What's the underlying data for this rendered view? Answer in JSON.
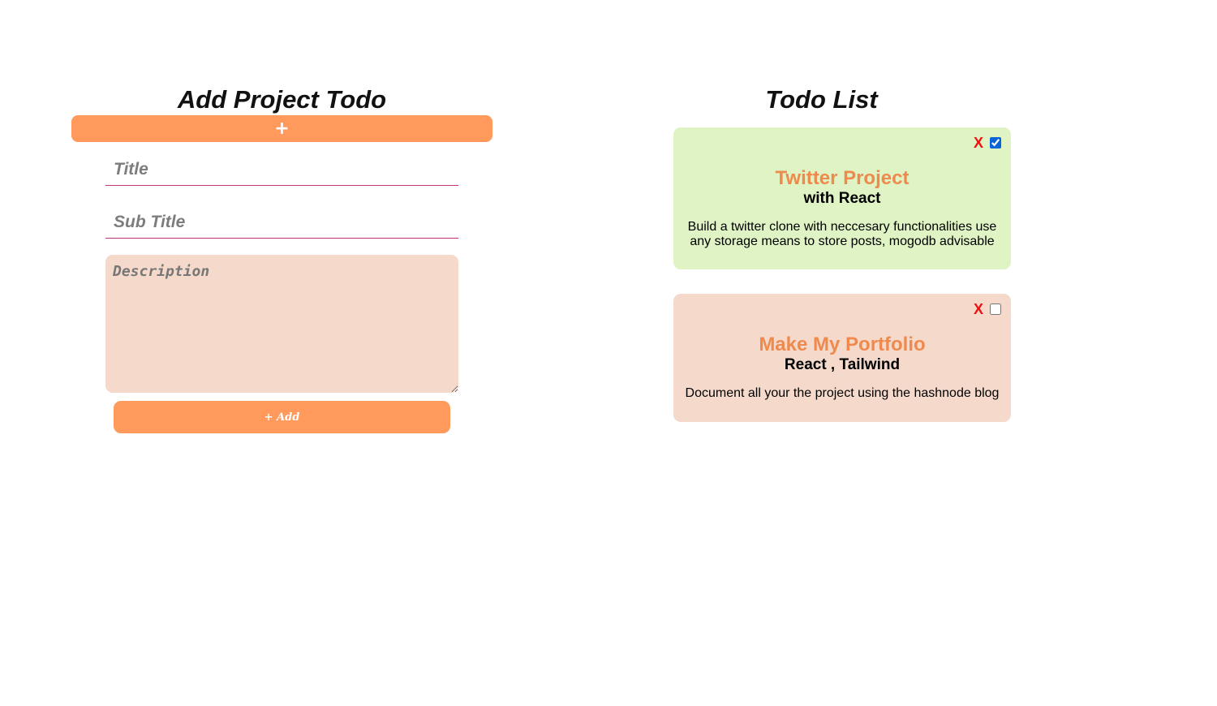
{
  "add_form": {
    "heading": "Add Project Todo",
    "toggle_label": "+",
    "title_placeholder": "Title",
    "subtitle_placeholder": "Sub Title",
    "description_placeholder": "Description",
    "add_label": "+ Add"
  },
  "todo_list": {
    "heading": "Todo List",
    "delete_label": "X",
    "items": [
      {
        "title": "Twitter Project",
        "subtitle": "with React",
        "description": "Build a twitter clone with neccesary functionalities use any storage means to store posts, mogodb advisable",
        "done": true,
        "background": "#dff3c4"
      },
      {
        "title": "Make My Portfolio",
        "subtitle": "React , Tailwind",
        "description": "Document all your the project using the hashnode blog",
        "done": false,
        "background": "#f5dacc"
      }
    ]
  },
  "colors": {
    "accent": "#ff9a5c",
    "card_title": "#ee8a4d",
    "delete": "#f01010",
    "underline": "#c2327a"
  }
}
